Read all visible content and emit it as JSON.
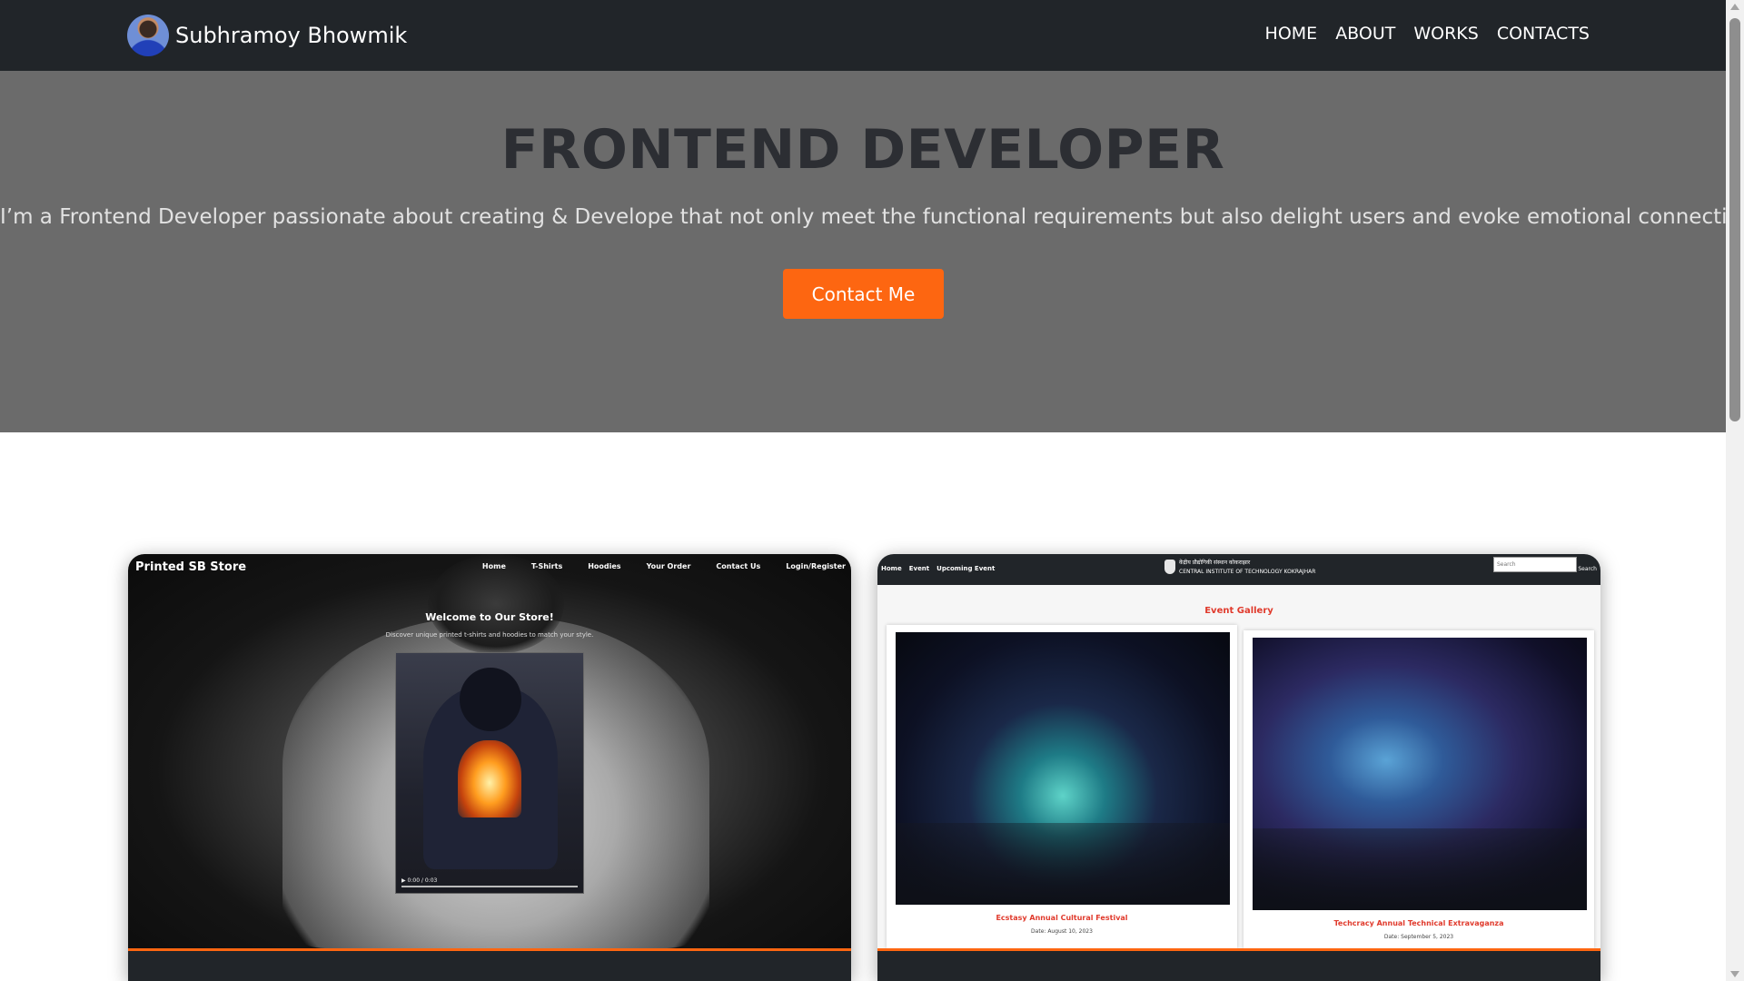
{
  "nav": {
    "brand_name": "Subhramoy Bhowmik",
    "links": [
      "HOME",
      "ABOUT",
      "WORKS",
      "CONTACTS"
    ]
  },
  "hero": {
    "title": "FRONTEND DEVELOPER",
    "subtitle": "I’m a Frontend Developer passionate about creating & Develope that not only meet the functional requirements but also delight users and evoke emotional connections.",
    "button_label": "Contact Me"
  },
  "works": [
    {
      "site_brand": "Printed SB Store",
      "nav": [
        "Home",
        "T-Shirts",
        "Hoodies",
        "Your Order",
        "Contact Us",
        "Login/Register"
      ],
      "welcome": "Welcome to Our Store!",
      "description": "Discover unique printed t-shirts and hoodies to match your style.",
      "video_time": "0:00 / 0:03"
    },
    {
      "nav": [
        "Home",
        "Event",
        "Upcoming Event"
      ],
      "institute_hindi": "केंद्रीय प्रौद्योगिकी संस्थान कोकराझार",
      "institute": "CENTRAL INSTITUTE OF TECHNOLOGY KOKRAJHAR",
      "search_placeholder": "Search",
      "search_button": "Search",
      "heading": "Event Gallery",
      "events": [
        {
          "title": "Ecstasy Annual Cultural Festival",
          "date": "Date: August 10, 2023"
        },
        {
          "title": "Techcracy Annual Technical Extravaganza",
          "date": "Date: September 5, 2023"
        }
      ]
    }
  ],
  "colors": {
    "navbar": "#212529",
    "hero_bg": "#6b6b6b",
    "accent": "#fd6611",
    "gallery_accent": "#e03a2c"
  }
}
